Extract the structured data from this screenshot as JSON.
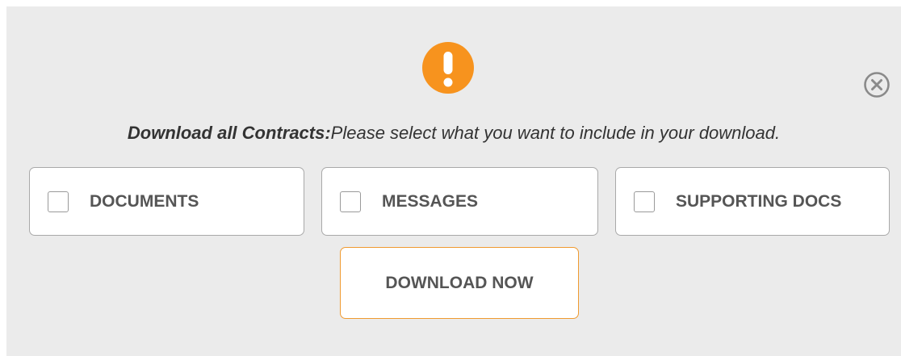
{
  "dialog": {
    "icons": {
      "alert": "exclamation-circle-icon",
      "close": "close-circle-icon"
    },
    "prompt": {
      "lead": "Download all Contracts:",
      "text": "Please select what you want to include in your download."
    },
    "options": [
      {
        "label": "DOCUMENTS",
        "checked": false
      },
      {
        "label": "MESSAGES",
        "checked": false
      },
      {
        "label": "SUPPORTING DOCS",
        "checked": false
      }
    ],
    "download_label": "DOWNLOAD NOW"
  },
  "colors": {
    "accent": "#f7931e",
    "background": "#ebebeb",
    "text": "#555555",
    "border": "#a9a9a9"
  }
}
